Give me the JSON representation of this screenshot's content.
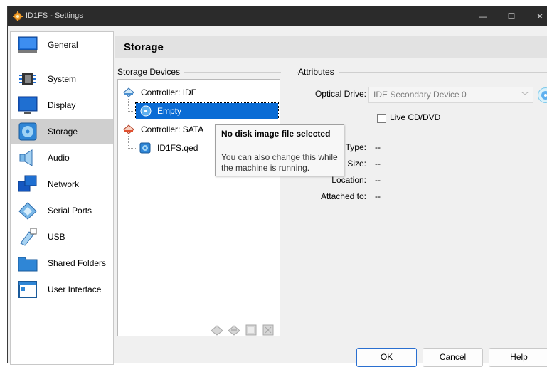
{
  "window": {
    "title": "ID1FS - Settings",
    "controls": {
      "minimize": "—",
      "maximize": "☐",
      "close": "✕"
    }
  },
  "sidebar": {
    "items": [
      {
        "label": "General",
        "icon": "general-icon"
      },
      {
        "label": "System",
        "icon": "chip-icon"
      },
      {
        "label": "Display",
        "icon": "monitor-icon"
      },
      {
        "label": "Storage",
        "icon": "disk-icon",
        "selected": true
      },
      {
        "label": "Audio",
        "icon": "speaker-icon"
      },
      {
        "label": "Network",
        "icon": "network-icon"
      },
      {
        "label": "Serial Ports",
        "icon": "serial-port-icon"
      },
      {
        "label": "USB",
        "icon": "usb-icon"
      },
      {
        "label": "Shared Folders",
        "icon": "folder-icon"
      },
      {
        "label": "User Interface",
        "icon": "window-icon"
      }
    ]
  },
  "page": {
    "title": "Storage"
  },
  "storage_devices": {
    "label": "Storage Devices",
    "tree": [
      {
        "label": "Controller: IDE",
        "kind": "controller"
      },
      {
        "label": "Empty",
        "kind": "optical",
        "selected": true
      },
      {
        "label": "Controller: SATA",
        "kind": "controller"
      },
      {
        "label": "ID1FS.qed",
        "kind": "disk"
      }
    ]
  },
  "tooltip": {
    "title": "No disk image file selected",
    "body": "You can also change this while the machine is running."
  },
  "attributes": {
    "label": "Attributes",
    "optical_drive_label": "Optical Drive:",
    "optical_drive_value": "IDE Secondary Device 0",
    "live_cd_label": "Live CD/DVD",
    "live_cd_checked": false
  },
  "information": {
    "rows": [
      {
        "label": "Type:",
        "value": "--"
      },
      {
        "label": "Size:",
        "value": "--"
      },
      {
        "label": "Location:",
        "value": "--"
      },
      {
        "label": "Attached to:",
        "value": "--"
      }
    ]
  },
  "buttons": {
    "ok": "OK",
    "cancel": "Cancel",
    "help": "Help"
  },
  "colors": {
    "selection": "#0a6cd5",
    "titlebar": "#2b2b2b",
    "accent_blue": "#1f6fd1"
  }
}
